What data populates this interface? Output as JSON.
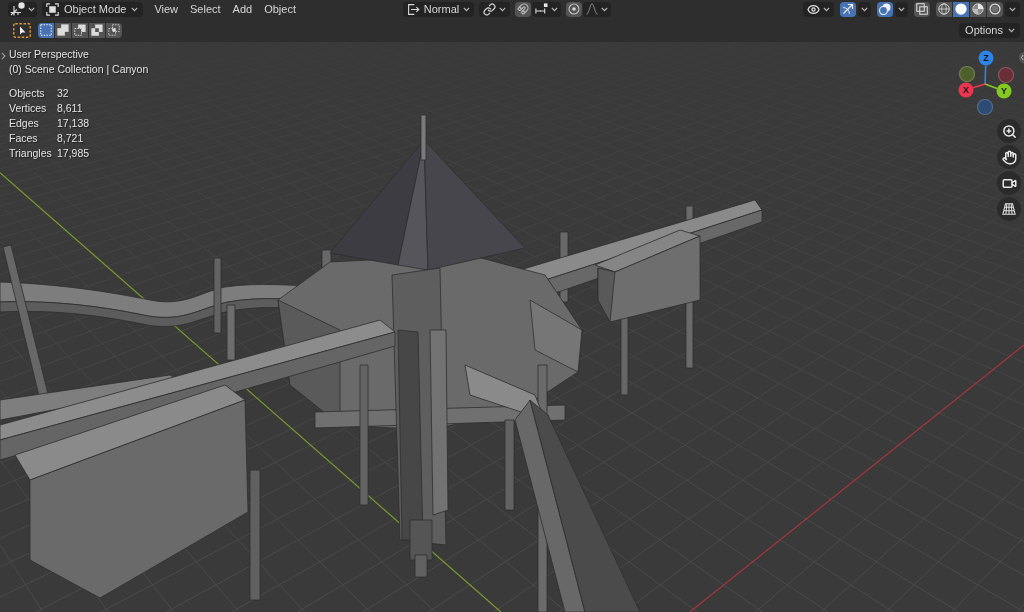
{
  "header": {
    "mode": {
      "label": "Object Mode"
    },
    "menus": [
      {
        "label": "View"
      },
      {
        "label": "Select"
      },
      {
        "label": "Add"
      },
      {
        "label": "Object"
      }
    ],
    "orientation": {
      "label": "Normal"
    },
    "snap": {
      "on": false
    },
    "proportional_editing": {
      "on": false
    },
    "gizmos": {
      "on": true
    },
    "overlays": {
      "on": true
    },
    "xray": {
      "on": false
    },
    "shading": [
      {
        "kind": "wireframe",
        "selected": false
      },
      {
        "kind": "solid",
        "selected": true
      },
      {
        "kind": "material",
        "selected": false
      },
      {
        "kind": "rendered",
        "selected": false
      }
    ]
  },
  "tool_settings": {
    "select_modes": [
      {
        "kind": "set",
        "selected": true
      },
      {
        "kind": "extend",
        "selected": false
      },
      {
        "kind": "subtract",
        "selected": false
      },
      {
        "kind": "difference",
        "selected": false
      },
      {
        "kind": "intersect",
        "selected": false
      }
    ],
    "options": {
      "label": "Options"
    }
  },
  "viewport": {
    "view_name": "User Perspective",
    "collection": "(0) Scene Collection | Canyon",
    "stats": [
      {
        "label": "Objects",
        "value": "32"
      },
      {
        "label": "Vertices",
        "value": "8,611"
      },
      {
        "label": "Edges",
        "value": "17,138"
      },
      {
        "label": "Faces",
        "value": "8,721"
      },
      {
        "label": "Triangles",
        "value": "17,985"
      }
    ]
  },
  "navigation_gizmo": {
    "axes": [
      {
        "kind": "positive",
        "label": "Z",
        "color": "#2f83e6"
      },
      {
        "kind": "negative",
        "color": "#4f5f2c"
      },
      {
        "kind": "negative",
        "color": "#6a2e38"
      },
      {
        "kind": "positive",
        "label": "X",
        "color": "#ee3550"
      },
      {
        "kind": "positive",
        "label": "Y",
        "color": "#85c920"
      },
      {
        "kind": "negative",
        "color": "#2c4a72"
      }
    ]
  }
}
